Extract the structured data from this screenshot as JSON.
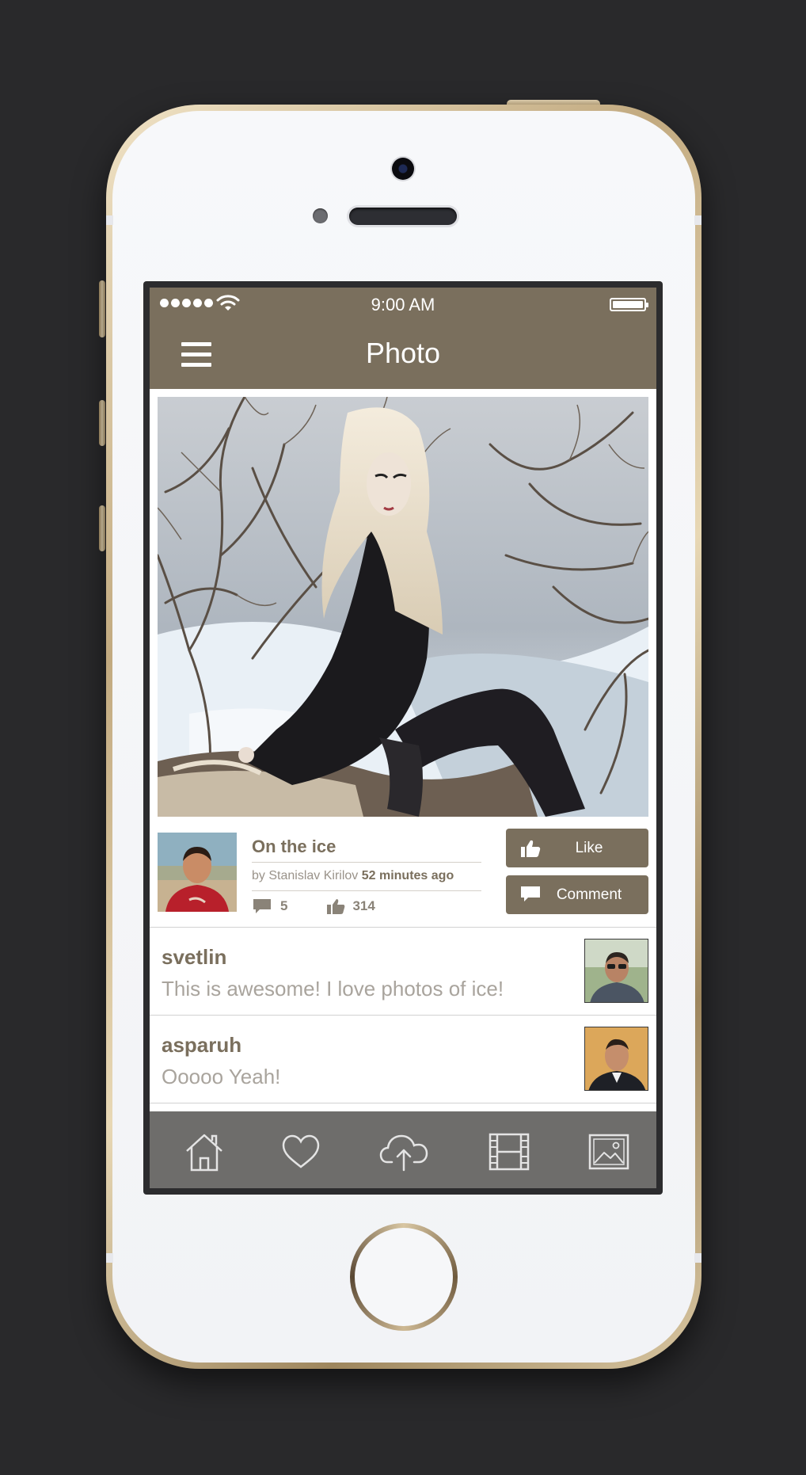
{
  "status_bar": {
    "time": "9:00 AM",
    "signal_bars": 5,
    "battery_level": 1.0
  },
  "nav": {
    "title": "Photo",
    "menu_icon": "hamburger-icon"
  },
  "post": {
    "title": "On the ice",
    "by_prefix": "by Stanislav Kirilov",
    "time_ago": "52 minutes ago",
    "comments_count": "5",
    "likes_count": "314"
  },
  "actions": {
    "like_label": "Like",
    "comment_label": "Comment"
  },
  "comments": [
    {
      "user": "svetlin",
      "text": "This is awesome! I love photos of ice!"
    },
    {
      "user": "asparuh",
      "text": "Ooooo Yeah!"
    }
  ],
  "tabs": [
    {
      "icon": "home-icon"
    },
    {
      "icon": "heart-icon"
    },
    {
      "icon": "cloud-upload-icon"
    },
    {
      "icon": "film-icon"
    },
    {
      "icon": "image-icon"
    }
  ],
  "colors": {
    "brand": "#7a6f5d",
    "tab_bar": "#6e6d6b",
    "background": "#29292b"
  }
}
